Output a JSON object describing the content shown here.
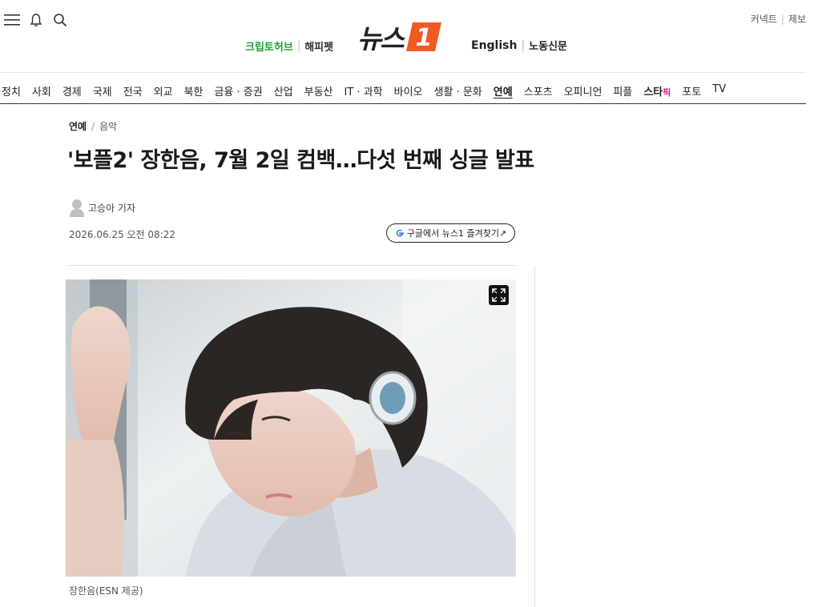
{
  "header": {
    "menu_icon": "hamburger-icon",
    "bell_icon": "bell-icon",
    "search_icon": "search-icon",
    "top_links": [
      "커넥트",
      "제보"
    ],
    "left_links": [
      "크립토허브",
      "해피펫"
    ],
    "logo_text": "뉴스",
    "logo_badge": "1",
    "right_links": [
      "English",
      "노동신문"
    ],
    "brand_color": "#f15a22",
    "green_color": "#1f9d39"
  },
  "nav": {
    "items": [
      "정치",
      "사회",
      "경제",
      "국제",
      "전국",
      "외교",
      "북한",
      "금융 · 증권",
      "산업",
      "부동산",
      "IT · 과학",
      "바이오",
      "생활 · 문화",
      "연예",
      "스포츠",
      "오피니언",
      "피플"
    ],
    "starpick_main": "스타",
    "starpick_sub": "픽",
    "tail_items": [
      "포토",
      "TV"
    ],
    "active": "연예"
  },
  "article": {
    "breadcrumb": [
      "연예",
      "음악"
    ],
    "headline": "'보플2' 장한음, 7월 2일 컴백…다섯 번째 싱글 발표",
    "reporter": "고승아 기자",
    "date": "2026.06.25 오전 08:22",
    "google_button": "구글에서 뉴스1 즐겨찾기↗",
    "google_mark": "G",
    "photo_caption": "장한음(ESN 제공)",
    "expand_icon": "expand-icon"
  }
}
